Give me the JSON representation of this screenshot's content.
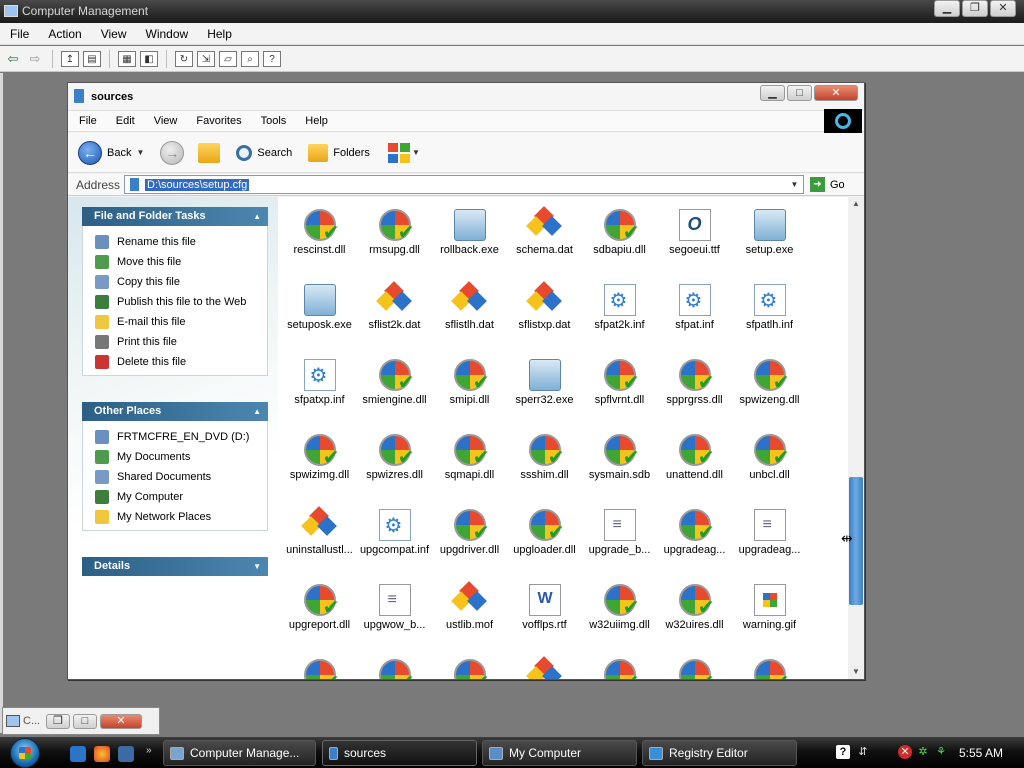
{
  "outer_window": {
    "title": "Computer Management",
    "menu": [
      "File",
      "Action",
      "View",
      "Window",
      "Help"
    ]
  },
  "explorer": {
    "title": "sources",
    "menu": [
      "File",
      "Edit",
      "View",
      "Favorites",
      "Tools",
      "Help"
    ],
    "toolbar": {
      "back_label": "Back",
      "search_label": "Search",
      "folders_label": "Folders"
    },
    "address": {
      "label": "Address",
      "value": "D:\\sources\\setup.cfg",
      "go_label": "Go"
    },
    "tasks": {
      "file_folder_title": "File and Folder Tasks",
      "file_folder_items": [
        {
          "label": "Rename this file",
          "icon": "rename-icon"
        },
        {
          "label": "Move this file",
          "icon": "move-icon"
        },
        {
          "label": "Copy this file",
          "icon": "copy-icon"
        },
        {
          "label": "Publish this file to the Web",
          "icon": "globe-icon"
        },
        {
          "label": "E-mail this file",
          "icon": "email-icon"
        },
        {
          "label": "Print this file",
          "icon": "printer-icon"
        },
        {
          "label": "Delete this file",
          "icon": "delete-icon"
        }
      ],
      "other_places_title": "Other Places",
      "other_places_items": [
        {
          "label": "FRTMCFRE_EN_DVD (D:)",
          "icon": "dvd-drive-icon"
        },
        {
          "label": "My Documents",
          "icon": "my-documents-icon"
        },
        {
          "label": "Shared Documents",
          "icon": "shared-documents-icon"
        },
        {
          "label": "My Computer",
          "icon": "my-computer-icon"
        },
        {
          "label": "My Network Places",
          "icon": "network-places-icon"
        }
      ],
      "details_title": "Details"
    },
    "files": [
      {
        "name": "rescinst.dll",
        "type": "dll"
      },
      {
        "name": "rmsupg.dll",
        "type": "dll"
      },
      {
        "name": "rollback.exe",
        "type": "exe"
      },
      {
        "name": "schema.dat",
        "type": "dat"
      },
      {
        "name": "sdbapiu.dll",
        "type": "dll"
      },
      {
        "name": "segoeui.ttf",
        "type": "ttf"
      },
      {
        "name": "setup.exe",
        "type": "exe"
      },
      {
        "name": "setuposk.exe",
        "type": "exe"
      },
      {
        "name": "sflist2k.dat",
        "type": "dat"
      },
      {
        "name": "sflistlh.dat",
        "type": "dat"
      },
      {
        "name": "sflistxp.dat",
        "type": "dat"
      },
      {
        "name": "sfpat2k.inf",
        "type": "inf"
      },
      {
        "name": "sfpat.inf",
        "type": "inf"
      },
      {
        "name": "sfpatlh.inf",
        "type": "inf"
      },
      {
        "name": "sfpatxp.inf",
        "type": "inf"
      },
      {
        "name": "smiengine.dll",
        "type": "dll"
      },
      {
        "name": "smipi.dll",
        "type": "dll"
      },
      {
        "name": "sperr32.exe",
        "type": "exe"
      },
      {
        "name": "spflvrnt.dll",
        "type": "dll"
      },
      {
        "name": "spprgrss.dll",
        "type": "dll"
      },
      {
        "name": "spwizeng.dll",
        "type": "dll"
      },
      {
        "name": "spwizimg.dll",
        "type": "dll"
      },
      {
        "name": "spwizres.dll",
        "type": "dll"
      },
      {
        "name": "sqmapi.dll",
        "type": "dll"
      },
      {
        "name": "ssshim.dll",
        "type": "dll"
      },
      {
        "name": "sysmain.sdb",
        "type": "dll"
      },
      {
        "name": "unattend.dll",
        "type": "dll"
      },
      {
        "name": "unbcl.dll",
        "type": "dll"
      },
      {
        "name": "uninstallustl...",
        "type": "dat"
      },
      {
        "name": "upgcompat.inf",
        "type": "inf"
      },
      {
        "name": "upgdriver.dll",
        "type": "dll"
      },
      {
        "name": "upgloader.dll",
        "type": "dll"
      },
      {
        "name": "upgrade_b...",
        "type": "doc"
      },
      {
        "name": "upgradeag...",
        "type": "dll"
      },
      {
        "name": "upgradeag...",
        "type": "doc"
      },
      {
        "name": "upgreport.dll",
        "type": "dll"
      },
      {
        "name": "upgwow_b...",
        "type": "doc"
      },
      {
        "name": "ustlib.mof",
        "type": "dat"
      },
      {
        "name": "vofflps.rtf",
        "type": "rtf"
      },
      {
        "name": "w32uiimg.dll",
        "type": "dll"
      },
      {
        "name": "w32uires.dll",
        "type": "dll"
      },
      {
        "name": "warning.gif",
        "type": "gif"
      },
      {
        "name": "",
        "type": "dll"
      },
      {
        "name": "",
        "type": "dll"
      },
      {
        "name": "",
        "type": "dll"
      },
      {
        "name": "",
        "type": "dat"
      },
      {
        "name": "",
        "type": "dll"
      },
      {
        "name": "",
        "type": "dll"
      },
      {
        "name": "",
        "type": "dll"
      }
    ]
  },
  "minimized_window": {
    "title": "C..."
  },
  "taskbar": {
    "tasks": [
      {
        "label": "Computer Manage...",
        "icon": "computer-management-icon"
      },
      {
        "label": "sources",
        "icon": "folder-icon"
      },
      {
        "label": "My Computer",
        "icon": "my-computer-icon"
      },
      {
        "label": "Registry Editor",
        "icon": "registry-editor-icon"
      }
    ],
    "clock": "5:55 AM"
  }
}
